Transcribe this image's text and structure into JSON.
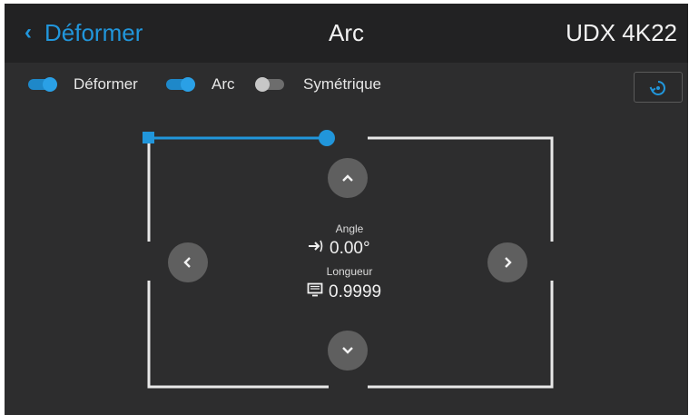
{
  "header": {
    "back_label": "Déformer",
    "title": "Arc",
    "device": "UDX 4K22"
  },
  "toggles": [
    {
      "label": "Déformer",
      "state": "on"
    },
    {
      "label": "Arc",
      "state": "on"
    },
    {
      "label": "Symétrique",
      "state": "off"
    }
  ],
  "center": {
    "angle_label": "Angle",
    "angle_value": "0.00°",
    "length_label": "Longueur",
    "length_value": "0.9999"
  },
  "colors": {
    "accent": "#2196db",
    "background": "#2d2d2e",
    "header": "#222223",
    "button": "#5f5f5f"
  },
  "icons": {
    "back": "chevron-left-icon",
    "reset": "reset-icon",
    "up": "chevron-up-icon",
    "down": "chevron-down-icon",
    "left": "chevron-left-icon",
    "right": "chevron-right-icon",
    "angle": "angle-arrow-icon",
    "length": "screen-icon"
  }
}
